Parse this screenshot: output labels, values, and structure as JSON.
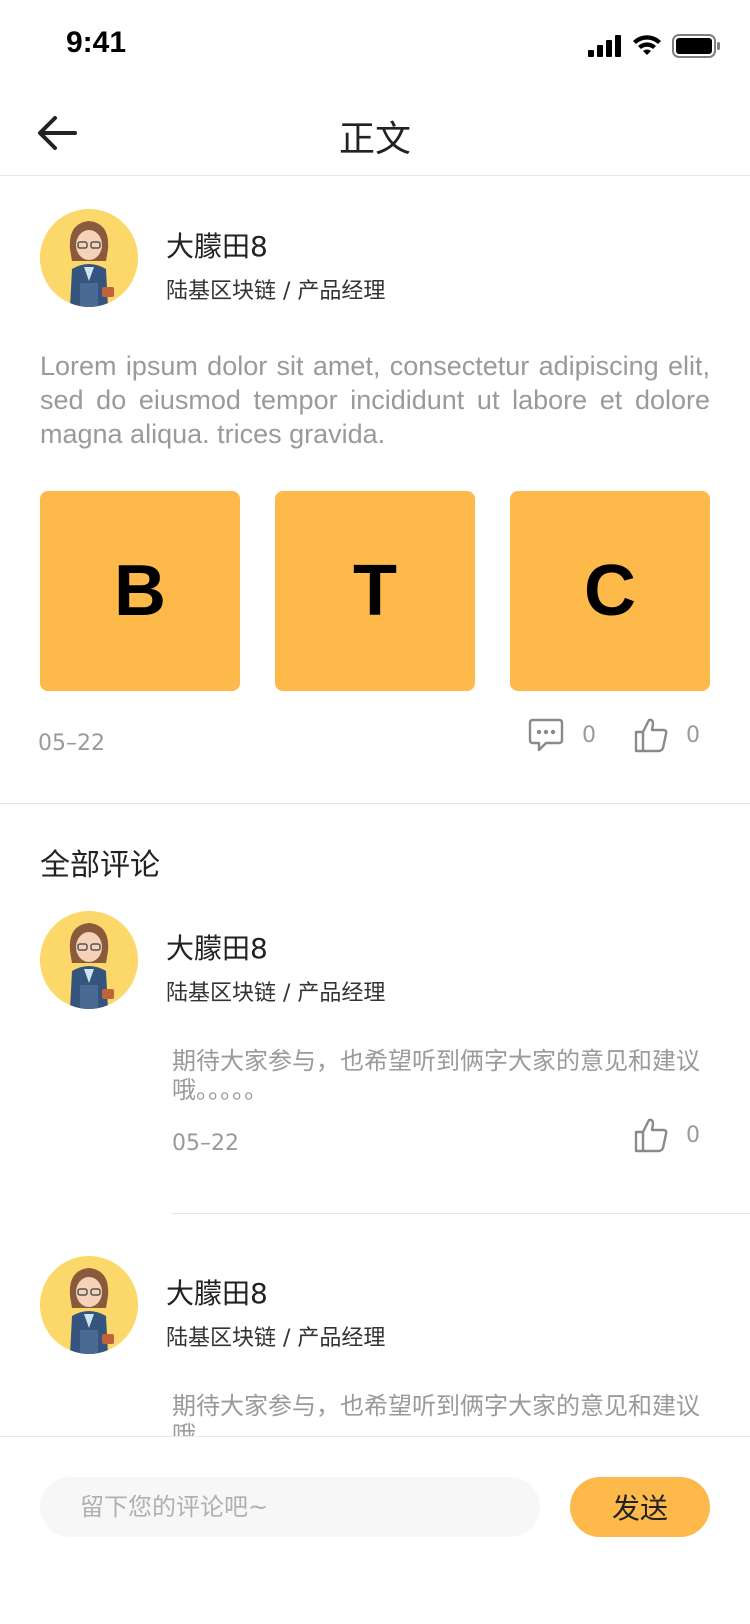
{
  "status_bar": {
    "time": "9:41"
  },
  "nav": {
    "title": "正文"
  },
  "post": {
    "author": {
      "name": "大朦田8",
      "meta": "陆基区块链 / 产品经理"
    },
    "body": "Lorem ipsum dolor sit amet, consectetur adipiscing elit, sed do eiusmod tempor incididunt ut labore et dolore magna aliqua. trices gravida.",
    "tiles": [
      "B",
      "T",
      "C"
    ],
    "date": "05–22",
    "comment_count": "0",
    "like_count": "0"
  },
  "comments": {
    "title": "全部评论",
    "items": [
      {
        "name": "大朦田8",
        "meta": "陆基区块链 / 产品经理",
        "text": "期待大家参与，也希望听到俩字大家的意见和建议哦。。。。。",
        "date": "05–22",
        "like_count": "0"
      },
      {
        "name": "大朦田8",
        "meta": "陆基区块链 / 产品经理",
        "text": "期待大家参与，也希望听到俩字大家的意见和建议哦。"
      }
    ]
  },
  "bottom_bar": {
    "input_placeholder": "留下您的评论吧~",
    "send_label": "发送"
  },
  "colors": {
    "accent": "#fdb94a",
    "avatar_bg": "#fcd86a",
    "muted_text": "#9a9a9a",
    "divider": "#e6e6e6"
  }
}
